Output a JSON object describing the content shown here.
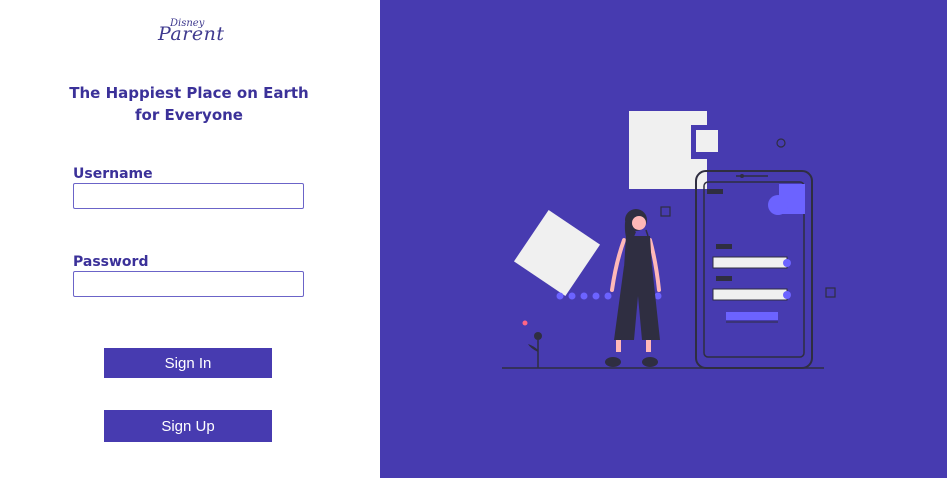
{
  "logo": {
    "small": "Disney",
    "main": "Parent"
  },
  "tagline": "The Happiest Place on Earth for Everyone",
  "form": {
    "username_label": "Username",
    "username_value": "",
    "password_label": "Password",
    "password_value": ""
  },
  "buttons": {
    "sign_in": "Sign In",
    "sign_up": "Sign Up"
  },
  "colors": {
    "brand": "#473bb0",
    "label": "#3b3199",
    "illustration_accent": "#6c63ff",
    "illustration_dark": "#2f2e41",
    "illustration_light": "#f0f0f0"
  },
  "illustration": {
    "name": "woman-with-phone-login-illustration"
  }
}
